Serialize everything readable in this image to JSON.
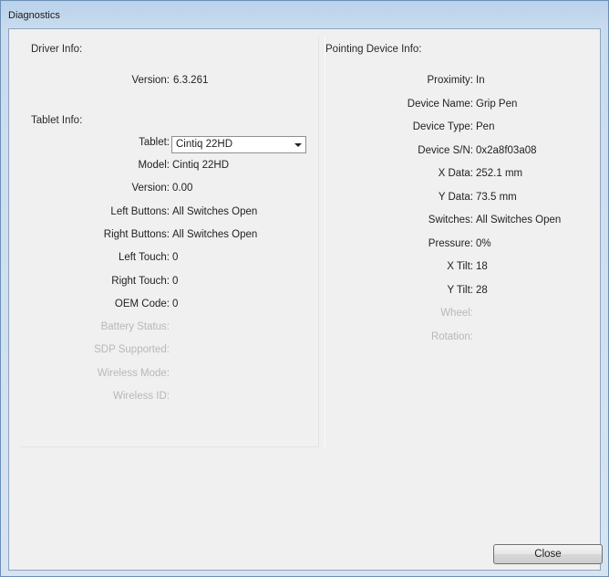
{
  "window": {
    "title": "Diagnostics"
  },
  "driver": {
    "heading": "Driver Info:",
    "version_label": "Version:",
    "version_value": "6.3.261"
  },
  "tablet": {
    "heading": "Tablet Info:",
    "tablet_label": "Tablet:",
    "tablet_selected": "Cintiq 22HD",
    "rows": [
      {
        "label": "Model:",
        "value": "Cintiq 22HD",
        "disabled": false
      },
      {
        "label": "Version:",
        "value": "0.00",
        "disabled": false
      },
      {
        "label": "Left Buttons:",
        "value": "All Switches Open",
        "disabled": false
      },
      {
        "label": "Right Buttons:",
        "value": "All Switches Open",
        "disabled": false
      },
      {
        "label": "Left Touch:",
        "value": "0",
        "disabled": false
      },
      {
        "label": "Right Touch:",
        "value": "0",
        "disabled": false
      },
      {
        "label": "OEM Code:",
        "value": "0",
        "disabled": false
      },
      {
        "label": "Battery Status:",
        "value": "",
        "disabled": true
      },
      {
        "label": "SDP Supported:",
        "value": "",
        "disabled": true
      },
      {
        "label": "Wireless Mode:",
        "value": "",
        "disabled": true
      },
      {
        "label": "Wireless ID:",
        "value": "",
        "disabled": true
      }
    ]
  },
  "pointing": {
    "heading": "Pointing Device Info:",
    "rows": [
      {
        "label": "Proximity:",
        "value": "In",
        "disabled": false
      },
      {
        "label": "Device Name:",
        "value": "Grip Pen",
        "disabled": false
      },
      {
        "label": "Device Type:",
        "value": "Pen",
        "disabled": false
      },
      {
        "label": "Device S/N:",
        "value": "0x2a8f03a08",
        "disabled": false
      },
      {
        "label": "X Data:",
        "value": "252.1 mm",
        "disabled": false
      },
      {
        "label": "Y Data:",
        "value": "73.5 mm",
        "disabled": false
      },
      {
        "label": "Switches:",
        "value": "All Switches Open",
        "disabled": false
      },
      {
        "label": "Pressure:",
        "value": "0%",
        "disabled": false
      },
      {
        "label": "X Tilt:",
        "value": "18",
        "disabled": false
      },
      {
        "label": "Y Tilt:",
        "value": "28",
        "disabled": false
      },
      {
        "label": "Wheel:",
        "value": "",
        "disabled": true
      },
      {
        "label": "Rotation:",
        "value": "",
        "disabled": true
      }
    ]
  },
  "buttons": {
    "close_label": "Close"
  }
}
